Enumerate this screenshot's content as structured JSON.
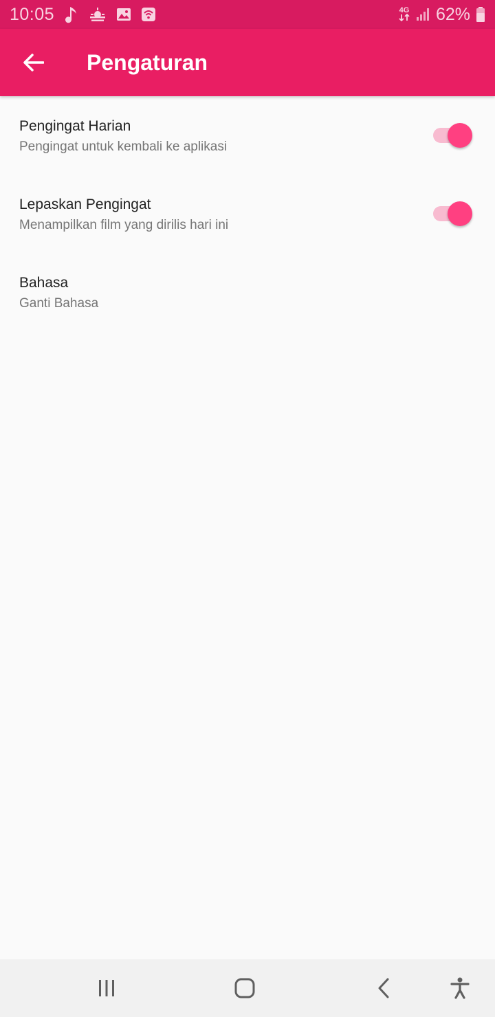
{
  "status_bar": {
    "time": "10:05",
    "battery_percent": "62%",
    "network_type": "4G",
    "icons": [
      "music-note-icon",
      "weather-icon",
      "gallery-icon",
      "wifi-hotspot-icon",
      "mobile-data-icon",
      "signal-icon",
      "battery-icon"
    ]
  },
  "app_bar": {
    "title": "Pengaturan",
    "back_icon": "arrow-left-icon",
    "color": "#e91e63"
  },
  "preferences": [
    {
      "title": "Pengingat Harian",
      "summary": "Pengingat untuk kembali ke aplikasi",
      "switch_on": true
    },
    {
      "title": "Lepaskan Pengingat",
      "summary": "Menampilkan film yang dirilis hari ini",
      "switch_on": true
    },
    {
      "title": "Bahasa",
      "summary": "Ganti Bahasa"
    }
  ],
  "nav_bar": {
    "icons": [
      "recent-apps-icon",
      "home-icon",
      "back-icon",
      "accessibility-icon"
    ]
  },
  "colors": {
    "status_bar": "#d81b60",
    "accent": "#ff4081",
    "switch_track": "#f8bbd0"
  }
}
